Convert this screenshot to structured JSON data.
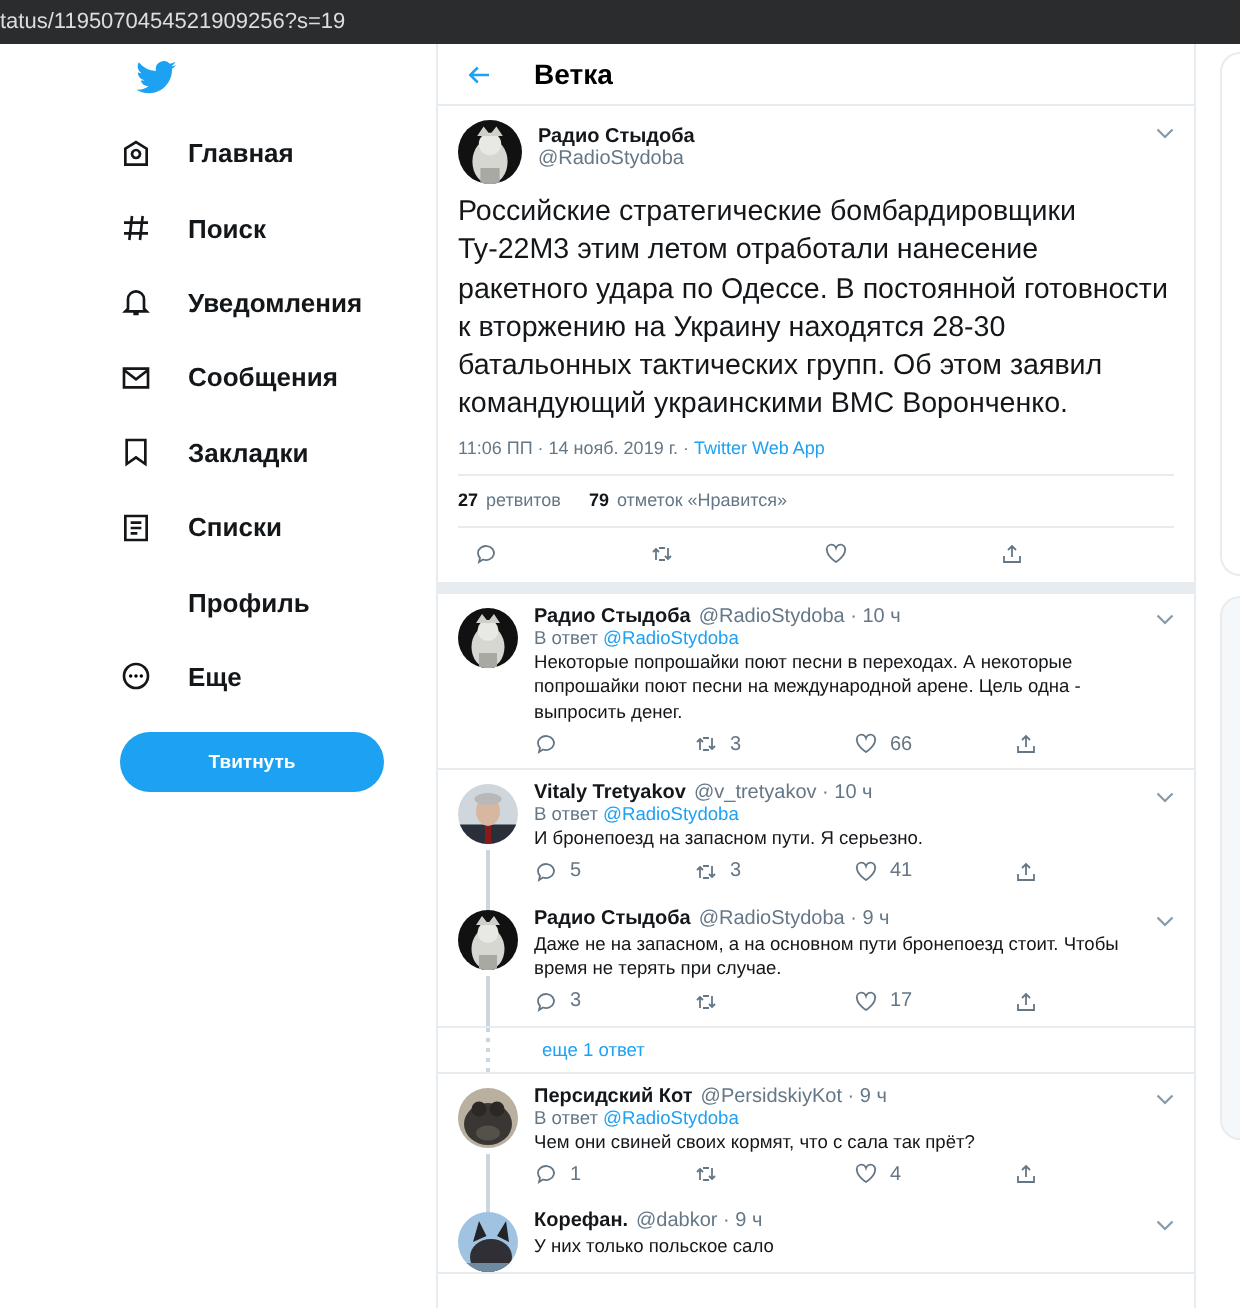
{
  "address_bar": {
    "url": "tatus/1195070454521909256?s=19"
  },
  "sidebar": {
    "items": [
      {
        "label": "Главная"
      },
      {
        "label": "Поиск"
      },
      {
        "label": "Уведомления"
      },
      {
        "label": "Сообщения"
      },
      {
        "label": "Закладки"
      },
      {
        "label": "Списки"
      },
      {
        "label": "Профиль"
      },
      {
        "label": "Еще"
      }
    ],
    "tweet_button": "Твитнуть"
  },
  "header": {
    "title": "Ветка"
  },
  "main_tweet": {
    "name": "Радио Стыдоба",
    "handle": "@RadioStydoba",
    "text": "Российские стратегические бомбардировщики Ту-22М3 этим летом отработали нанесение ракетного удара по Одессе. В постоянной готовности к вторжению на Украину находятся 28-30 батальонных тактических групп. Об этом заявил командующий украинскими ВМС Воронченко.",
    "time": "11:06 ПП · 14 нояб. 2019 г. · ",
    "source": "Twitter Web App",
    "retweets": "27",
    "retweets_label": "ретвитов",
    "likes": "79",
    "likes_label": "отметок «Нравится»"
  },
  "replies": [
    {
      "kind": "reply",
      "name": "Радио Стыдоба",
      "handle": "@RadioStydoba · 10 ч",
      "reply_prefix": "В ответ ",
      "reply_to": "@RadioStydoba",
      "text": "Некоторые попрошайки поют песни в переходах. А некоторые попрошайки поют песни на международной арене. Цель одна - выпросить денег.",
      "retweets": "3",
      "likes": "66",
      "thread_line": false
    },
    {
      "kind": "reply",
      "name": "Vitaly Tretyakov",
      "handle": "@v_tretyakov · 10 ч",
      "reply_prefix": "В ответ ",
      "reply_to": "@RadioStydoba",
      "text": "И бронепоезд на запасном пути. Я серьезно.",
      "replies": "5",
      "retweets": "3",
      "likes": "41",
      "thread_line": false
    },
    {
      "kind": "reply",
      "name": "Радио Стыдоба",
      "handle": "@RadioStydoba · 9 ч",
      "text": "Даже не на запасном, а на основном пути бронепоезд стоит. Чтобы время не терять при случае.",
      "replies": "3",
      "likes": "17",
      "thread_line": true
    },
    {
      "kind": "more",
      "label": "еще 1 ответ"
    },
    {
      "kind": "reply",
      "name": "Персидский Кот",
      "handle": "@PersidskiyKot · 9 ч",
      "reply_prefix": "В ответ ",
      "reply_to": "@RadioStydoba",
      "text": "Чем они свиней своих кормят, что с сала так прёт?",
      "replies": "1",
      "likes": "4",
      "thread_line": false
    },
    {
      "kind": "reply",
      "name": "Корефан.",
      "handle": "@dabkor · 9 ч",
      "text": "У них только польское сало",
      "thread_line": true
    }
  ]
}
